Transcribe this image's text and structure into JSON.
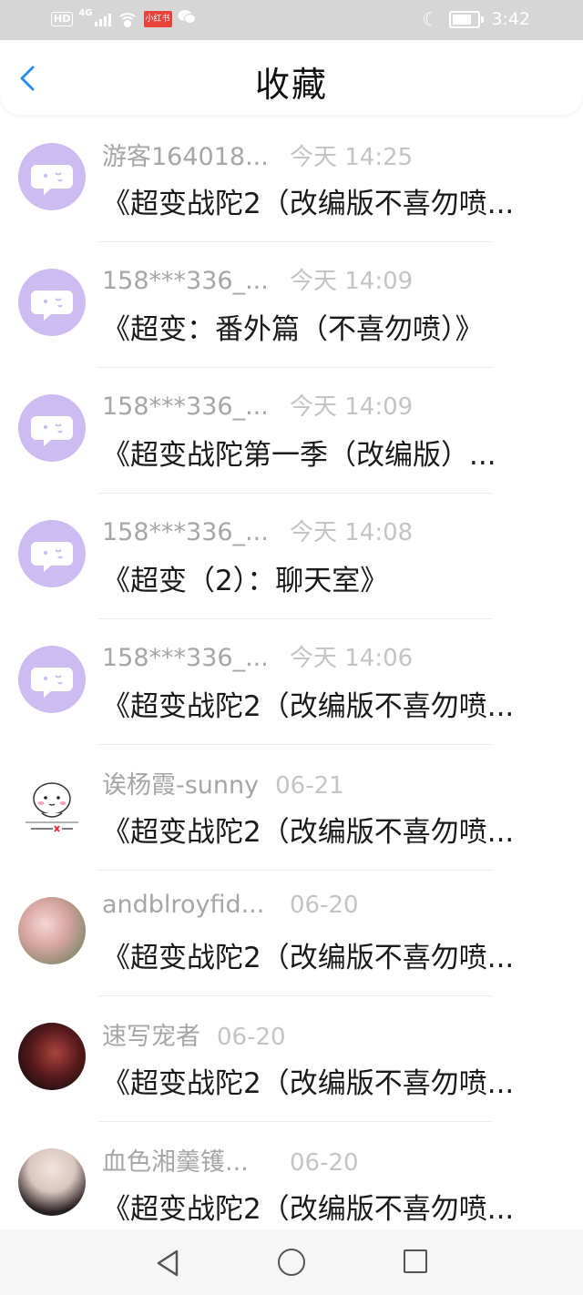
{
  "status_bar": {
    "hd": "HD",
    "network": "4G",
    "app_badge": "小红书",
    "time": "3:42",
    "battery_level": 0.75
  },
  "header": {
    "title": "收藏"
  },
  "items": [
    {
      "user": "游客164018...",
      "time": "今天 14:25",
      "title": "《超变战陀2（改编版不喜勿喷...",
      "avatar": "chat-bubble"
    },
    {
      "user": "158***336_...",
      "time": "今天 14:09",
      "title": "《超变：番外篇（不喜勿喷）》",
      "avatar": "chat-bubble"
    },
    {
      "user": "158***336_...",
      "time": "今天 14:09",
      "title": "《超变战陀第一季（改编版）...",
      "avatar": "chat-bubble"
    },
    {
      "user": "158***336_...",
      "time": "今天 14:08",
      "title": "《超变（2）：聊天室》",
      "avatar": "chat-bubble"
    },
    {
      "user": "158***336_...",
      "time": "今天 14:06",
      "title": "《超变战陀2（改编版不喜勿喷...",
      "avatar": "chat-bubble"
    },
    {
      "user": "诶杨霞-sunny",
      "time": "06-21",
      "title": "《超变战陀2（改编版不喜勿喷...",
      "avatar": "sticker"
    },
    {
      "user": "andblroyfid...",
      "time": "06-20",
      "title": "《超变战陀2（改编版不喜勿喷...",
      "avatar": "flower-photo"
    },
    {
      "user": "速写宠者",
      "time": "06-20",
      "title": "《超变战陀2（改编版不喜勿喷...",
      "avatar": "anime-photo"
    },
    {
      "user": "血色湘羹镬...",
      "time": "06-20",
      "title": "《超变战陀2（改编版不喜勿喷...",
      "avatar": "girl-photo"
    }
  ],
  "nav_bar": {
    "back": "triangle-back-icon",
    "home": "circle-home-icon",
    "recent": "square-recent-icon"
  },
  "colors": {
    "chat_avatar_bg": "#cdbcf2",
    "back_arrow": "#2a8cf0",
    "username": "#a6a6a6",
    "timestamp": "#c4c4c4"
  }
}
